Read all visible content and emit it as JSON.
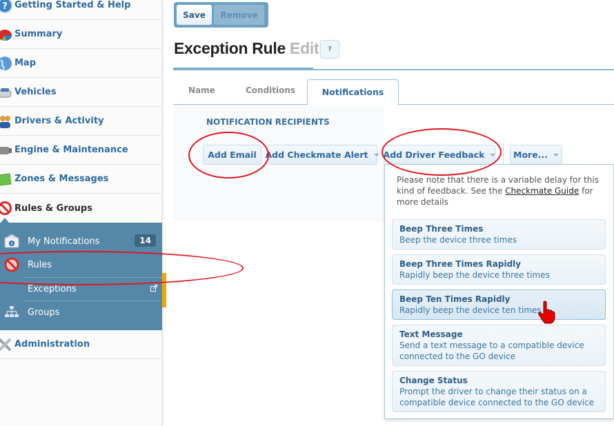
{
  "sidebar": {
    "items": [
      {
        "label": "Getting Started & Help",
        "icon": "help-icon"
      },
      {
        "label": "Summary",
        "icon": "pie-chart-icon"
      },
      {
        "label": "Map",
        "icon": "globe-icon"
      },
      {
        "label": "Vehicles",
        "icon": "car-icon"
      },
      {
        "label": "Drivers & Activity",
        "icon": "drivers-icon"
      },
      {
        "label": "Engine & Maintenance",
        "icon": "engine-icon"
      },
      {
        "label": "Zones & Messages",
        "icon": "zone-icon"
      },
      {
        "label": "Rules & Groups",
        "icon": "no-entry-icon"
      }
    ],
    "subitems": [
      {
        "label": "My Notifications",
        "badge": "14",
        "icon": "envelope-icon"
      },
      {
        "label": "Rules",
        "icon": "no-entry-icon"
      },
      {
        "label": "Exceptions",
        "icon": "external-link-icon"
      },
      {
        "label": "Groups",
        "icon": "hierarchy-icon"
      }
    ],
    "admin": {
      "label": "Administration",
      "icon": "tools-icon"
    }
  },
  "toolbar": {
    "save_label": "Save",
    "remove_label": "Remove"
  },
  "header": {
    "title": "Exception Rule",
    "mode": "Edit",
    "help": "?"
  },
  "tabs": [
    {
      "label": "Name"
    },
    {
      "label": "Conditions"
    },
    {
      "label": "Notifications",
      "active": true
    }
  ],
  "notifications": {
    "section_title": "NOTIFICATION RECIPIENTS",
    "buttons": {
      "add_email": "Add Email",
      "add_checkmate": "Add Checkmate Alert",
      "add_driver_feedback": "Add Driver Feedback",
      "more": "More..."
    }
  },
  "dropdown": {
    "note_before": "Please note that there is a variable delay for this kind of feedback. See the ",
    "note_link": "Checkmate Guide",
    "note_after": " for more details",
    "items": [
      {
        "title": "Beep Three Times",
        "desc": "Beep the device three times"
      },
      {
        "title": "Beep Three Times Rapidly",
        "desc": "Rapidly beep the device three times"
      },
      {
        "title": "Beep Ten Times Rapidly",
        "desc": "Rapidly beep the device ten times",
        "hover": true
      },
      {
        "title": "Text Message",
        "desc": "Send a text message to a compatible device connected to the GO device"
      },
      {
        "title": "Change Status",
        "desc": "Prompt the driver to change their status on a compatible device connected to the GO device"
      }
    ]
  },
  "colors": {
    "accent": "#2f6a9e",
    "subnav_bg": "#5588a8",
    "highlight": "#f5a700",
    "annotation": "#e0141e"
  }
}
